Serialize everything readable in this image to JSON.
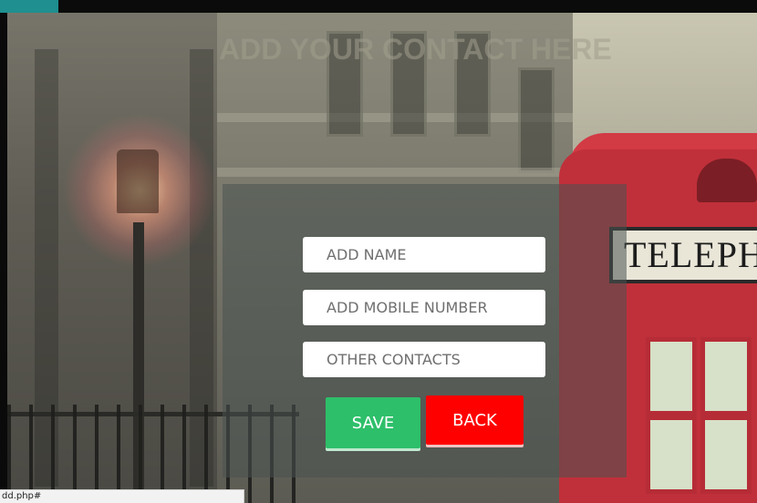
{
  "page": {
    "heading": "ADD YOUR CONTACT HERE"
  },
  "form": {
    "name_placeholder": "ADD NAME",
    "mobile_placeholder": "ADD MOBILE NUMBER",
    "other_placeholder": "OTHER CONTACTS",
    "save_label": "SAVE",
    "back_label": "BACK"
  },
  "background": {
    "booth_sign": "TELEPH"
  },
  "statusbar": {
    "url": "dd.php#"
  },
  "colors": {
    "save": "#2ebf6a",
    "back": "#ff0000",
    "tab_accent": "#1f8f8f"
  }
}
